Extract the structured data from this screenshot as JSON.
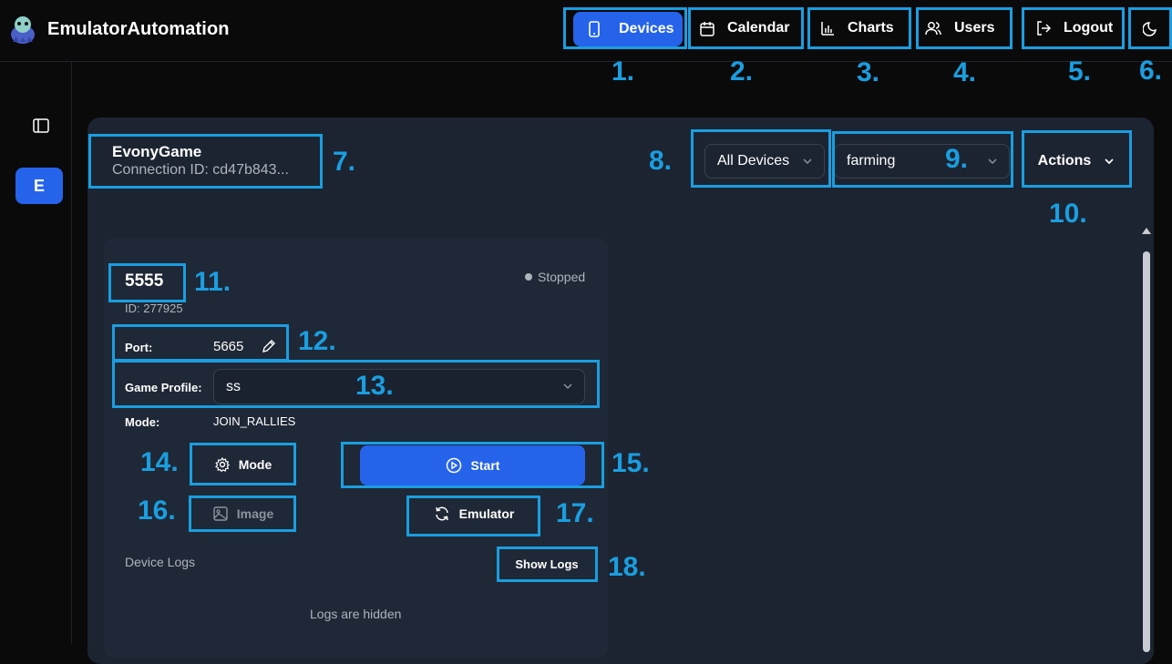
{
  "app": {
    "title": "EmulatorAutomation"
  },
  "nav": {
    "devices": "Devices",
    "calendar": "Calendar",
    "charts": "Charts",
    "users": "Users",
    "logout": "Logout"
  },
  "sidebar": {
    "avatar_letter": "E"
  },
  "header": {
    "game_name": "EvonyGame",
    "connection_id": "Connection ID: cd47b843..."
  },
  "filters": {
    "devices_select": "All Devices",
    "profile_select": "farming",
    "actions": "Actions"
  },
  "device": {
    "name": "5555",
    "id_text": "ID: 277925",
    "status": "Stopped",
    "port_label": "Port:",
    "port_value": "5665",
    "game_profile_label": "Game Profile:",
    "game_profile_value": "ss",
    "mode_label": "Mode:",
    "mode_value": "JOIN_RALLIES",
    "mode_button": "Mode",
    "start_button": "Start",
    "image_button": "Image",
    "emulator_button": "Emulator",
    "logs_title": "Device Logs",
    "show_logs_button": "Show Logs",
    "logs_hidden_text": "Logs are hidden"
  },
  "callouts": {
    "c1": "1.",
    "c2": "2.",
    "c3": "3.",
    "c4": "4.",
    "c5": "5.",
    "c6": "6.",
    "c7": "7.",
    "c8": "8.",
    "c9": "9.",
    "c10": "10.",
    "c11": "11.",
    "c12": "12.",
    "c13": "13.",
    "c14": "14.",
    "c15": "15.",
    "c16": "16.",
    "c17": "17.",
    "c18": "18."
  },
  "colors": {
    "accent": "#2563eb",
    "highlight": "#1a9ee0",
    "panel": "#1c2431"
  }
}
